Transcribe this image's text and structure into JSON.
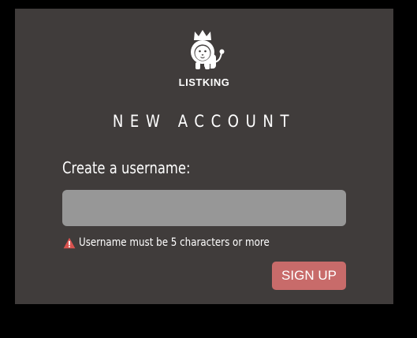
{
  "brand": {
    "name": "LISTKING",
    "logo_icon": "lion-with-crown-icon"
  },
  "form": {
    "title": "NEW ACCOUNT",
    "username_label": "Create a username:",
    "username_value": "",
    "username_placeholder": "",
    "error_icon": "warning-icon",
    "error_message": "Username must be 5 characters or more",
    "submit_label": "SIGN UP"
  },
  "colors": {
    "page_background": "#000000",
    "card_background": "#403c3b",
    "input_background": "#979797",
    "button_background": "#c86b6a",
    "warning_icon": "#d9534f",
    "text": "#ffffff"
  }
}
